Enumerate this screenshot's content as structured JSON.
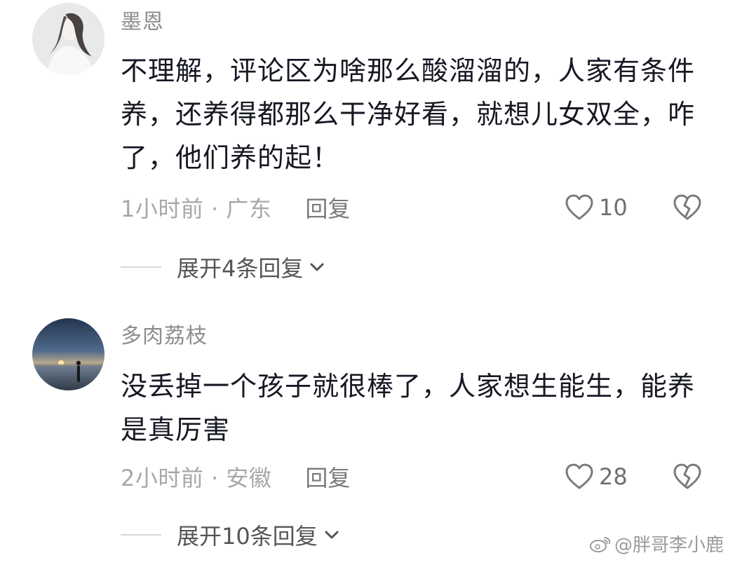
{
  "comments": [
    {
      "username": "墨恩",
      "avatar_icon": "girl-portrait-avatar",
      "content": "不理解，评论区为啥那么酸溜溜的，人家有条件养，还养得都那么干净好看，就想儿女双全，咋了，他们养的起！",
      "meta": "1小时前 · 广东",
      "reply_label": "回复",
      "like_count": "10",
      "expand_label": "展开4条回复"
    },
    {
      "username": "多肉荔枝",
      "avatar_icon": "sunset-lake-avatar",
      "content": "没丢掉一个孩子就很棒了，人家想生能生，能养是真厉害",
      "meta": "2小时前 · 安徽",
      "reply_label": "回复",
      "like_count": "28",
      "expand_label": "展开10条回复"
    }
  ],
  "watermark": {
    "icon": "weibo-logo-icon",
    "text": "@胖哥李小鹿"
  },
  "colors": {
    "text_primary": "#161823",
    "text_secondary": "#8c8c8c",
    "divider": "#d8d8d8"
  }
}
